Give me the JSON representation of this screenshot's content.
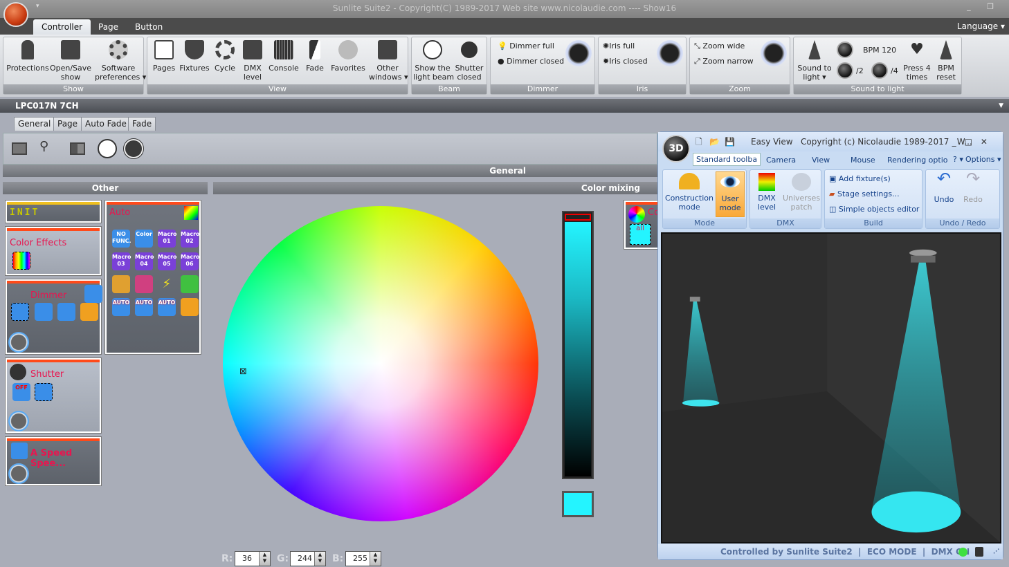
{
  "app": {
    "title": "Sunlite Suite2 - Copyright(C) 1989-2017    Web site www.nicolaudie.com ---- Show16",
    "language": "Language"
  },
  "ribbon_tabs": [
    "Controller",
    "Page",
    "Button"
  ],
  "groups": {
    "show": {
      "label": "Show",
      "buttons": [
        "Protections",
        "Open/Save\nshow",
        "Software\npreferences ▾"
      ]
    },
    "view": {
      "label": "View",
      "buttons": [
        "Pages",
        "Fixtures",
        "Cycle",
        "DMX\nlevel",
        "Console",
        "Fade",
        "Favorites",
        "Other\nwindows ▾"
      ]
    },
    "beam": {
      "label": "Beam",
      "buttons": [
        "Show the\nlight beam",
        "Shutter\nclosed"
      ]
    },
    "dimmer": {
      "label": "Dimmer",
      "buttons": [
        "Dimmer full",
        "Dimmer closed"
      ]
    },
    "iris": {
      "label": "Iris",
      "buttons": [
        "Iris full",
        "Iris closed"
      ]
    },
    "zoom": {
      "label": "Zoom",
      "buttons": [
        "Zoom wide",
        "Zoom narrow"
      ]
    },
    "sound": {
      "label": "Sound to light",
      "sound_to_light": "Sound to\nlight ▾",
      "bpm": "BPM 120",
      "half": "/2",
      "quarter": "/4",
      "press4": "Press 4\ntimes",
      "bpm_reset": "BPM\nreset"
    }
  },
  "fixture": {
    "name": "LPC017N 7CH"
  },
  "page_tabs": [
    "General",
    "Page",
    "Auto Fade",
    "Fade"
  ],
  "sections": {
    "general": "General",
    "other": "Other",
    "color_mixing": "Color mixing"
  },
  "panels": {
    "init": "INIT",
    "auto": "Auto",
    "color_effects": "Color Effects",
    "dimmer": "Dimmer",
    "shutter": "Shutter",
    "speed": "A Speed Spee...",
    "auto_tiles": [
      "NO FUNC.",
      "Color",
      "Macro 01",
      "Macro 02",
      "Macro 03",
      "Macro 04",
      "Macro 05",
      "Macro 06",
      "",
      "",
      "⚡",
      "",
      "AUTO",
      "AUTO",
      "AUTO",
      ""
    ],
    "shutter_off": "OFF",
    "color_panel_title": "Co",
    "color_all": "all"
  },
  "rgb": {
    "r_label": "R:",
    "g_label": "G:",
    "b_label": "B:",
    "r": "36",
    "g": "244",
    "b": "255",
    "current_color": "#24f4ff"
  },
  "view3d": {
    "title": "Easy View   Copyright (c) Nicolaudie 1989-2017   W...",
    "badge": "3D",
    "tabs": [
      "Standard toolba",
      "Camera",
      "View",
      "Mouse",
      "Rendering optio"
    ],
    "help": "? ▾",
    "options": "Options ▾",
    "mode": {
      "label": "Mode",
      "construction": "Construction\nmode",
      "user": "User\nmode"
    },
    "dmx": {
      "label": "DMX",
      "level": "DMX\nlevel",
      "patch": "Universes\npatch"
    },
    "build": {
      "label": "Build",
      "add": "Add fixture(s)",
      "stage": "Stage settings...",
      "objects": "Simple objects editor"
    },
    "undo": {
      "label": "Undo / Redo",
      "undo": "Undo",
      "redo": "Redo"
    },
    "status": "Controlled by Sunlite Suite2  |  ECO MODE  |  DMX ON"
  }
}
